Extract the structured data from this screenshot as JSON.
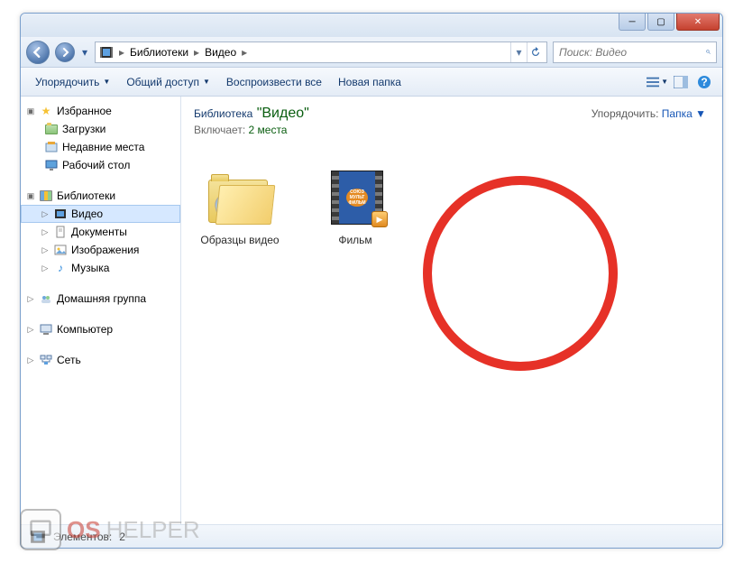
{
  "titlebar": {},
  "breadcrumb": {
    "p1": "Библиотеки",
    "p2": "Видео"
  },
  "search": {
    "placeholder": "Поиск: Видео"
  },
  "toolbar": {
    "organize": "Упорядочить",
    "share": "Общий доступ",
    "playall": "Воспроизвести все",
    "newfolder": "Новая папка"
  },
  "nav": {
    "fav": "Избранное",
    "downloads": "Загрузки",
    "recent": "Недавние места",
    "desktop": "Рабочий стол",
    "libs": "Библиотеки",
    "video": "Видео",
    "docs": "Документы",
    "images": "Изображения",
    "music": "Музыка",
    "homegroup": "Домашняя группа",
    "computer": "Компьютер",
    "network": "Сеть"
  },
  "header": {
    "lib_label": "Библиотека",
    "lib_name": "\"Видео\"",
    "includes_label": "Включает:",
    "includes_link": "2 места",
    "arrange_label": "Упорядочить:",
    "arrange_value": "Папка"
  },
  "items": {
    "i0": "Образцы видео",
    "i1": "Фильм"
  },
  "status": {
    "count_label": "Элементов:",
    "count": "2"
  },
  "watermark": {
    "a": "OS",
    "b": "HELPER"
  }
}
